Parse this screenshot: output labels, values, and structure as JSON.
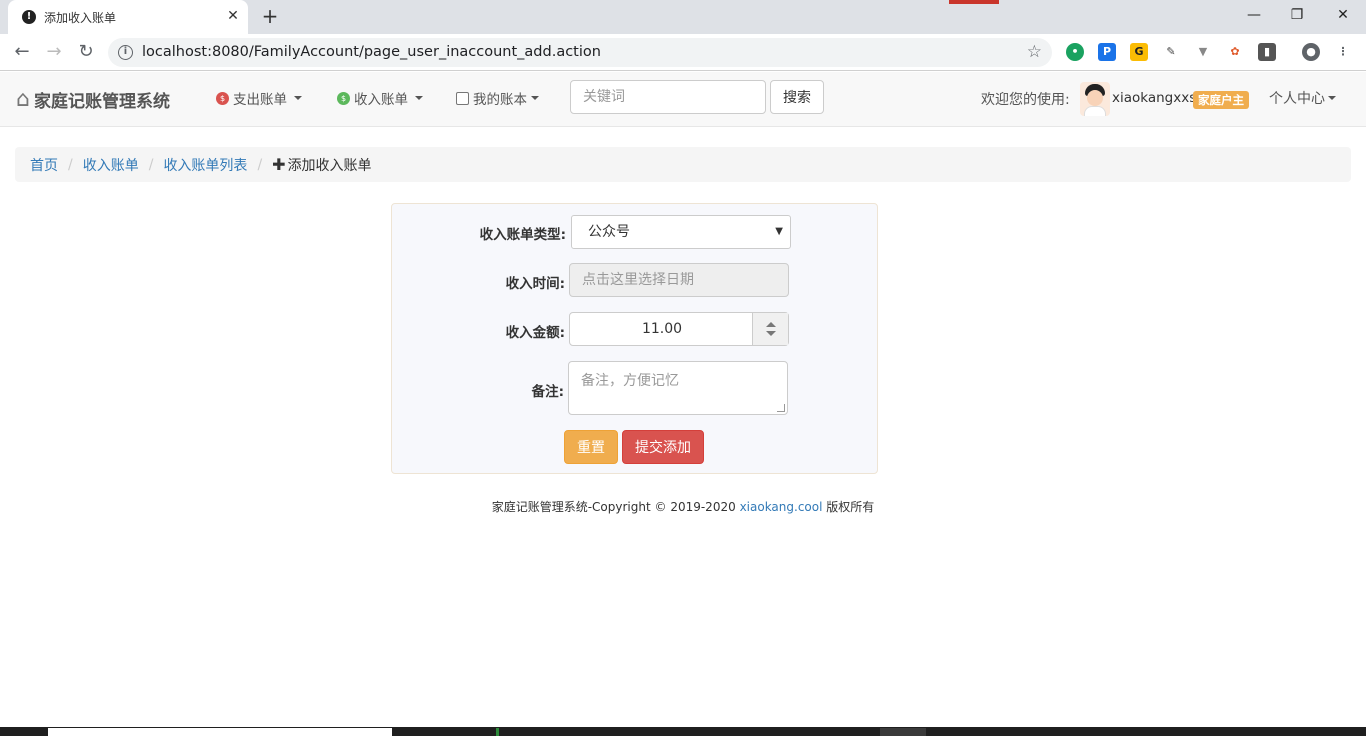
{
  "browser": {
    "tab_title": "添加收入账单",
    "url": "localhost:8080/FamilyAccount/page_user_inaccount_add.action"
  },
  "navbar": {
    "brand": "家庭记账管理系统",
    "menu": {
      "expense": "支出账单",
      "income": "收入账单",
      "mine": "我的账本"
    },
    "search": {
      "placeholder": "关键词",
      "button": "搜索"
    },
    "welcome": "欢迎您的使用:",
    "username": "xiaokangxxs",
    "role": "家庭户主",
    "personal_center": "个人中心"
  },
  "breadcrumb": {
    "home": "首页",
    "income": "收入账单",
    "income_list": "收入账单列表",
    "current": "添加收入账单"
  },
  "form": {
    "type_label": "收入账单类型:",
    "type_value": "公众号",
    "time_label": "收入时间:",
    "time_placeholder": "点击这里选择日期",
    "amount_label": "收入金额:",
    "amount_value": "11.00",
    "note_label": "备注:",
    "note_placeholder": "备注，方便记忆",
    "reset_button": "重置",
    "submit_button": "提交添加"
  },
  "footer": {
    "text": "家庭记账管理系统-Copyright © 2019-2020",
    "link": "xiaokang.cool",
    "suffix": "版权所有"
  },
  "colors": {
    "primary_link": "#337ab7",
    "warning": "#f0ad4e",
    "danger": "#d9534f"
  }
}
